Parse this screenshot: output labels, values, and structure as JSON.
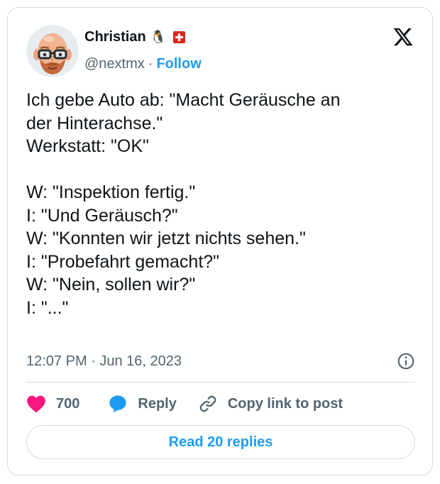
{
  "author": {
    "display_name": "Christian",
    "name_emoji": "🐧",
    "flag_icon": "swiss-flag-icon",
    "handle": "@nextmx",
    "separator": "·",
    "follow_label": "Follow"
  },
  "brand": {
    "logo_icon": "x-logo-icon"
  },
  "tweet": {
    "lines": [
      "Ich gebe Auto ab: \"Macht Geräusche an",
      "der Hinterachse.\"",
      "Werkstatt: \"OK\"",
      "",
      "W: \"Inspektion fertig.\"",
      "I: \"Und Geräusch?\"",
      "W: \"Konnten wir jetzt nichts sehen.\"",
      "I: \"Probefahrt gemacht?\"",
      "W: \"Nein, sollen wir?\"",
      "I: \"...\""
    ],
    "timestamp": "12:07 PM · Jun 16, 2023"
  },
  "actions": {
    "like_count": "700",
    "reply_label": "Reply",
    "copy_link_label": "Copy link to post",
    "read_replies_label": "Read 20 replies"
  },
  "colors": {
    "like": "#f91880",
    "reply": "#1d9bf0",
    "link": "#1d9bf0",
    "secondary_text": "#536471",
    "flag_red": "#da291c"
  }
}
